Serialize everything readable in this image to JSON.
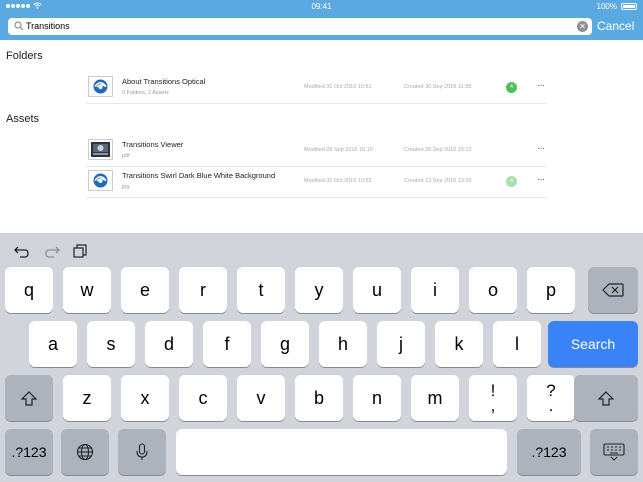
{
  "status_bar": {
    "time": "09:41",
    "battery": "100%"
  },
  "search": {
    "query": "Transitions",
    "cancel_label": "Cancel"
  },
  "folders_section": {
    "title": "Folders",
    "items": [
      {
        "name": "About Transitions Optical",
        "subtitle": "0 Folders, 2 Assets",
        "modified": "Modified 31 Oct 2016 10:51",
        "created": "Created 30 Sep 2016 11:38",
        "badge": "4",
        "badge_color": "#4cc15a",
        "more": "···"
      }
    ]
  },
  "assets_section": {
    "title": "Assets",
    "items": [
      {
        "name": "Transitions Viewer",
        "subtitle": "pdf",
        "modified": "Modified 28 Sep 2016 16:15",
        "created": "Created 28 Sep 2016 15:12",
        "more": "···"
      },
      {
        "name": "Transitions Swirl Dark Blue White Background",
        "subtitle": "jpg",
        "modified": "Modified 31 Oct 2016 10:55",
        "created": "Created 13 Sep 2016 13:20",
        "badge": "4",
        "badge_color": "#a6e0ae",
        "more": "···"
      }
    ]
  },
  "keyboard": {
    "row1": [
      "q",
      "w",
      "e",
      "r",
      "t",
      "y",
      "u",
      "i",
      "o",
      "p"
    ],
    "row2": [
      "a",
      "s",
      "d",
      "f",
      "g",
      "h",
      "j",
      "k",
      "l"
    ],
    "row3": [
      "z",
      "x",
      "c",
      "v",
      "b",
      "n",
      "m"
    ],
    "exclaim_top": "!",
    "exclaim_bottom": ",",
    "question_top": "?",
    "question_bottom": ".",
    "search_label": "Search",
    "numbers_label": ".?123"
  }
}
